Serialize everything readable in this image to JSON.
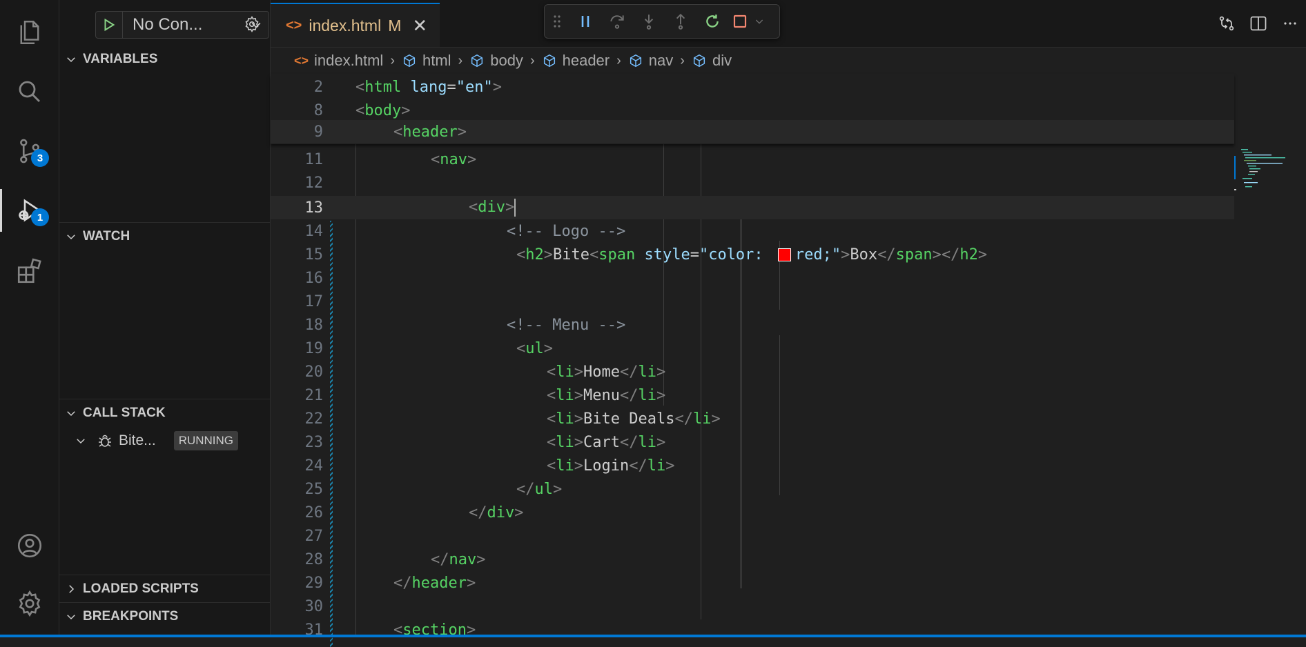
{
  "debug": {
    "config_name": "No Con...",
    "sections": {
      "variables": "VARIABLES",
      "watch": "WATCH",
      "call_stack": "CALL STACK",
      "loaded_scripts": "LOADED SCRIPTS",
      "breakpoints": "BREAKPOINTS"
    },
    "call_stack_item": {
      "name": "Bite...",
      "status": "RUNNING"
    }
  },
  "activity": {
    "source_control_badge": "3",
    "run_debug_badge": "1"
  },
  "tab": {
    "label": "index.html",
    "modified": "M"
  },
  "breadcrumb": [
    "index.html",
    "html",
    "body",
    "header",
    "nav",
    "div"
  ],
  "sticky_lines": [
    {
      "n": "2",
      "code": "<html lang=\"en\">"
    },
    {
      "n": "8",
      "code": "<body>"
    },
    {
      "n": "9",
      "code": "<header>"
    }
  ],
  "lines": [
    {
      "n": "11",
      "text": "<nav>"
    },
    {
      "n": "12",
      "text": ""
    },
    {
      "n": "13",
      "text": "<div>"
    },
    {
      "n": "14",
      "text": "<!-- Logo -->"
    },
    {
      "n": "15",
      "text": "<h2>Bite<span style=\"color: red;\">Box</span></h2>"
    },
    {
      "n": "16",
      "text": ""
    },
    {
      "n": "17",
      "text": ""
    },
    {
      "n": "18",
      "text": "<!-- Menu -->"
    },
    {
      "n": "19",
      "text": "<ul>"
    },
    {
      "n": "20",
      "text": "<li>Home</li>"
    },
    {
      "n": "21",
      "text": "<li>Menu</li>"
    },
    {
      "n": "22",
      "text": "<li>Bite Deals</li>"
    },
    {
      "n": "23",
      "text": "<li>Cart</li>"
    },
    {
      "n": "24",
      "text": "<li>Login</li>"
    },
    {
      "n": "25",
      "text": "</ul>"
    },
    {
      "n": "26",
      "text": "</div>"
    },
    {
      "n": "27",
      "text": ""
    },
    {
      "n": "28",
      "text": "</nav>"
    },
    {
      "n": "29",
      "text": "</header>"
    },
    {
      "n": "30",
      "text": ""
    },
    {
      "n": "31",
      "text": "<section>"
    }
  ],
  "colors": {
    "accent": "#0078d4",
    "tag": "#56d364",
    "attr": "#9cdcfe",
    "string": "#ce9178"
  }
}
